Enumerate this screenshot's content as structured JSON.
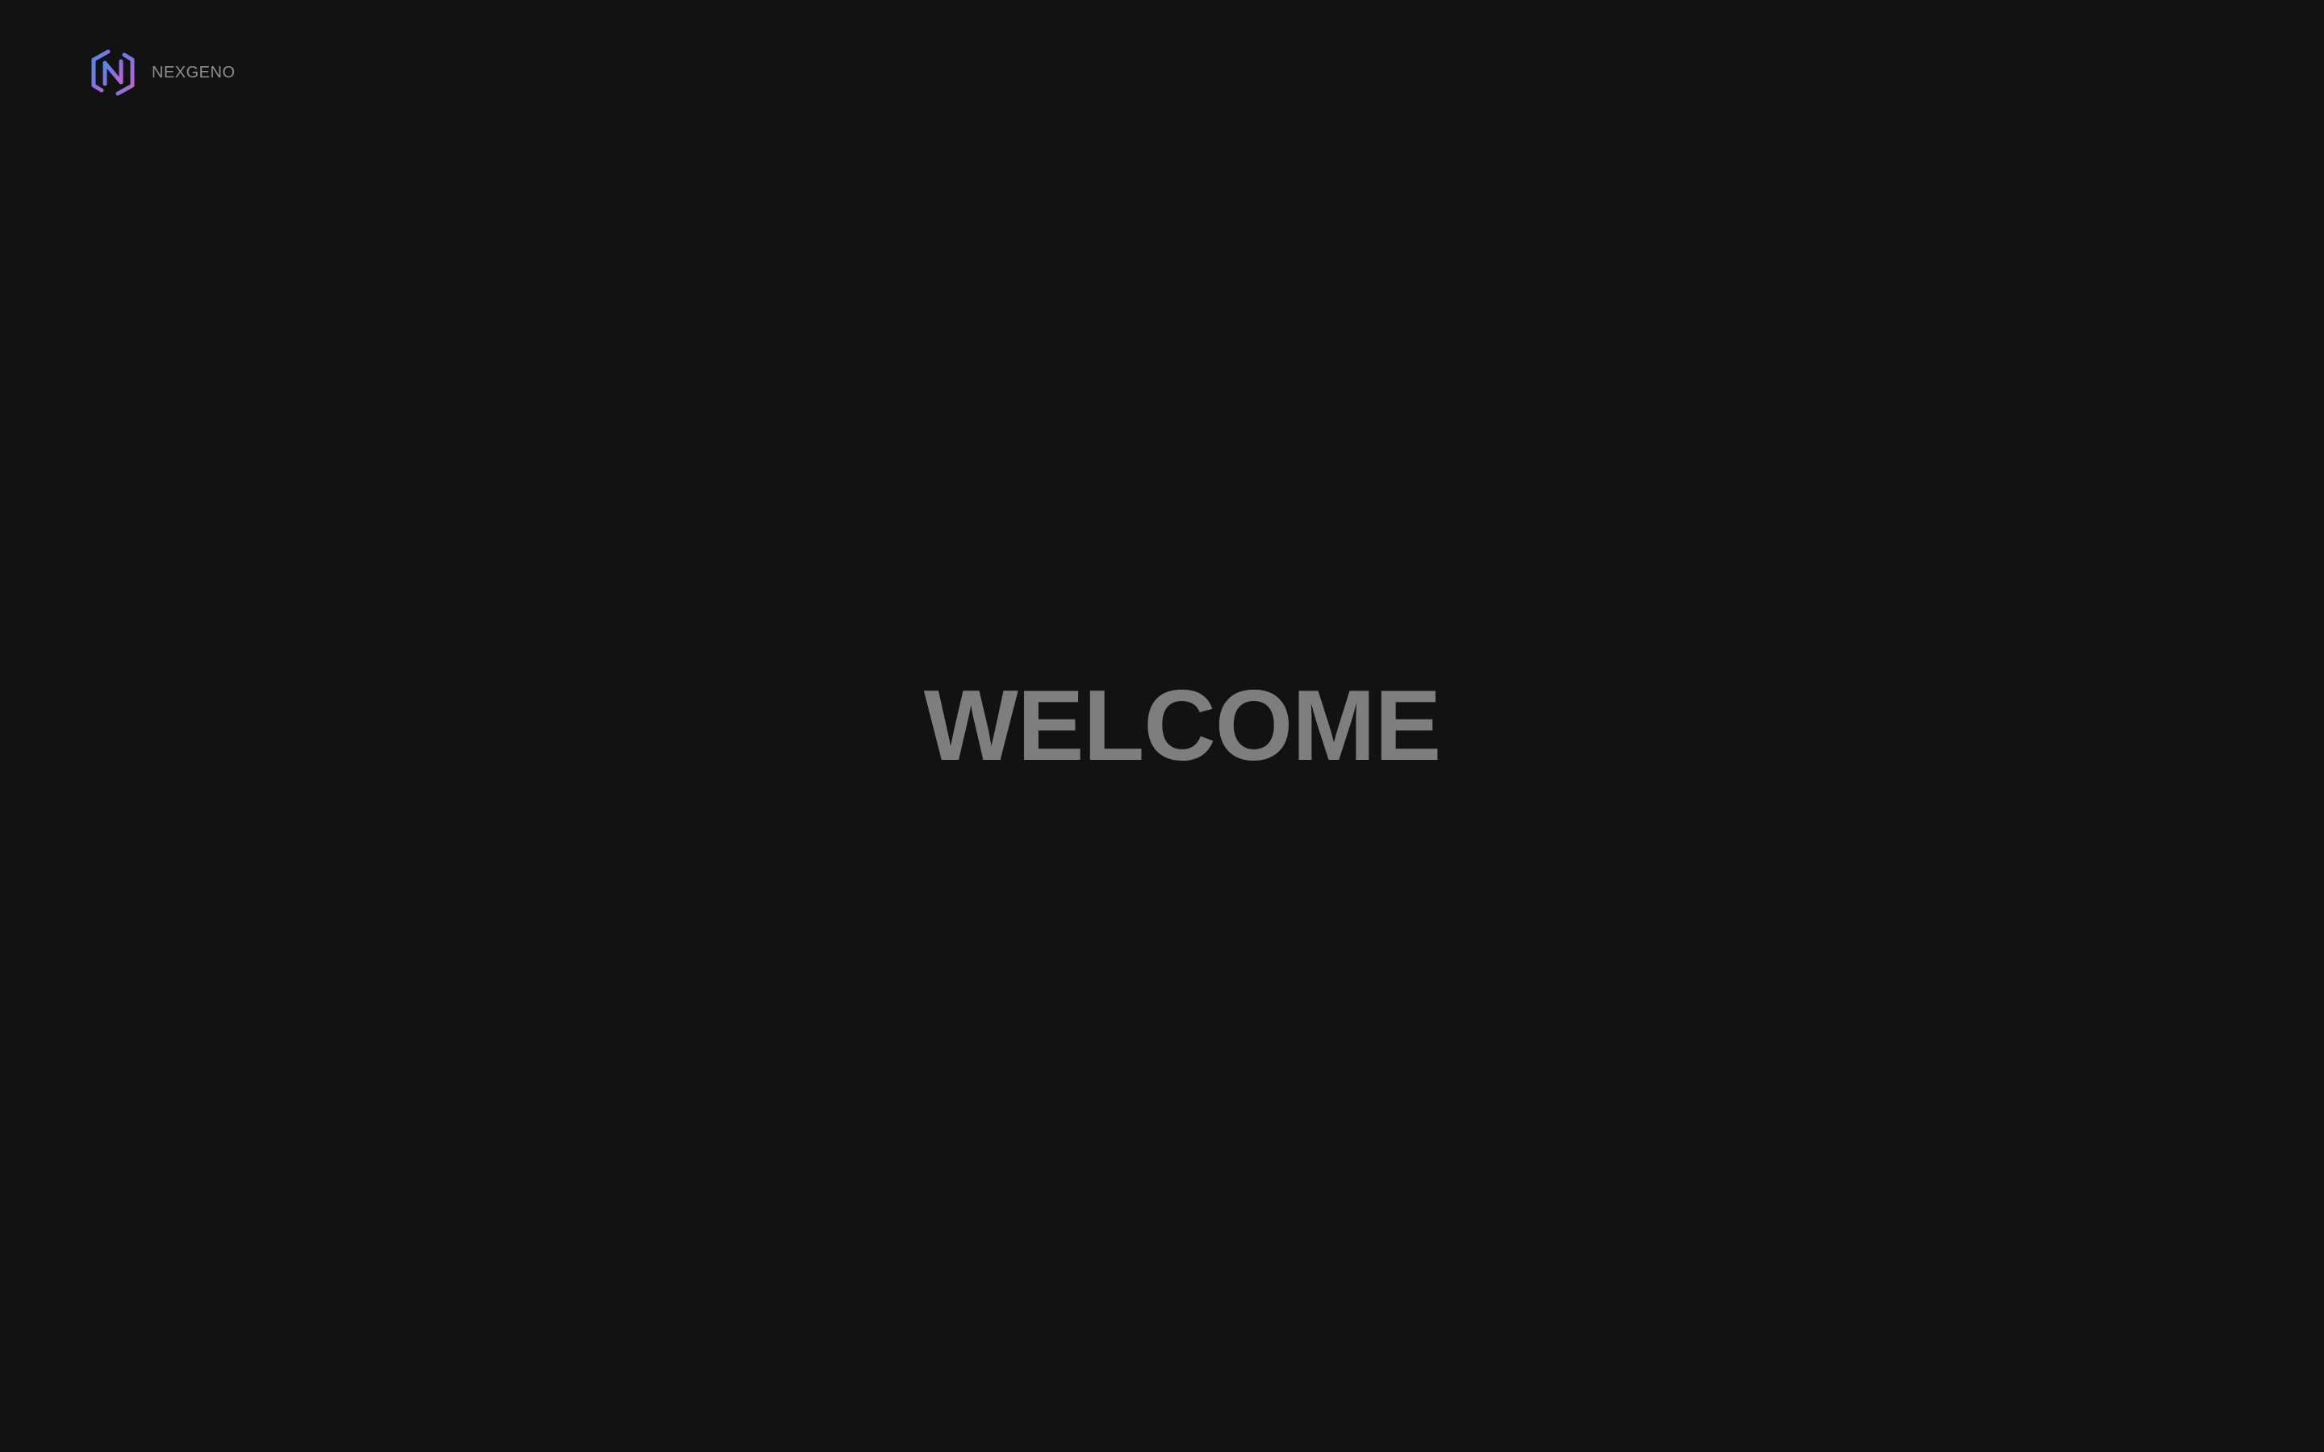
{
  "brand": {
    "name": "NEXGENO",
    "logo_icon": "nexgeno-hexagon-logo",
    "logo_gradient": [
      "#4e8de6",
      "#8a6fe0",
      "#c563c4"
    ]
  },
  "hero": {
    "title": "WELCOME"
  },
  "colors": {
    "background": "#121212",
    "brand_text": "#8e8e8e",
    "title_text": "#7e7e7e"
  }
}
